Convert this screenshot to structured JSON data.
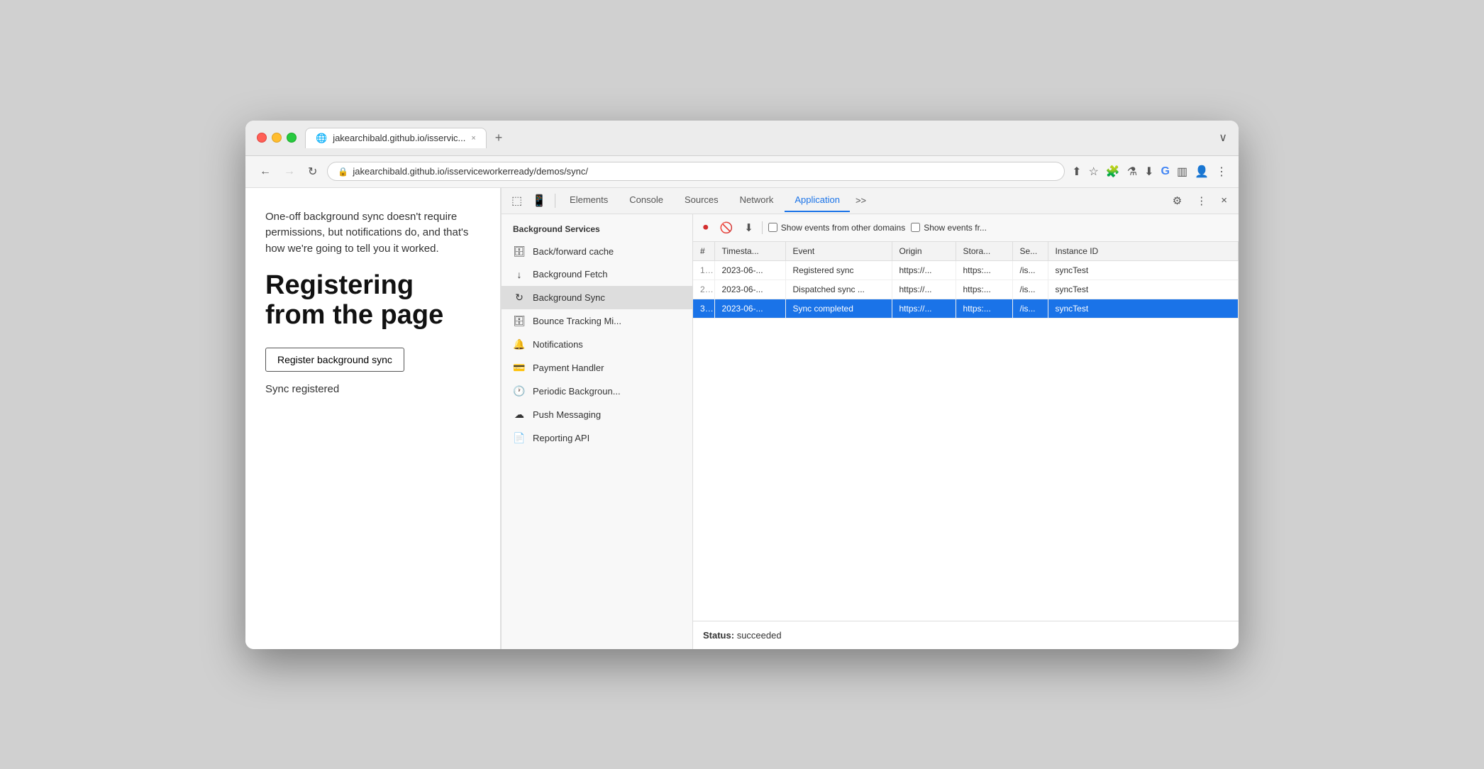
{
  "browser": {
    "tab_label": "jakearchibald.github.io/isservic...",
    "tab_close": "×",
    "tab_new": "+",
    "tab_overflow": "∨",
    "nav_back": "←",
    "nav_forward": "→",
    "nav_refresh": "↻",
    "address_lock": "🔒",
    "address_url_highlight": "jakearchibald.github.io",
    "address_url_path": "/isserviceworkerready/demos/sync/",
    "address_full": "jakearchibald.github.io/isserviceworkerready/demos/sync/"
  },
  "page": {
    "description": "One-off background sync doesn't require permissions, but notifications do, and that's how we're going to tell you it worked.",
    "heading": "Registering from the page",
    "register_btn": "Register background sync",
    "sync_status": "Sync registered"
  },
  "devtools": {
    "tabs": [
      "Elements",
      "Console",
      "Sources",
      "Network",
      "Application"
    ],
    "active_tab": "Application",
    "more_tabs": ">>",
    "settings_icon": "⚙",
    "more_icon": "⋮",
    "close_icon": "×"
  },
  "panel": {
    "record_icon": "⏺",
    "clear_icon": "🚫",
    "download_icon": "⬇",
    "checkbox1_label": "Show events from other domains",
    "checkbox2_label": "Show events fr..."
  },
  "sidebar": {
    "section_title": "Background Services",
    "items": [
      {
        "id": "back-forward-cache",
        "icon": "🗄",
        "label": "Back/forward cache"
      },
      {
        "id": "background-fetch",
        "icon": "↓",
        "label": "Background Fetch"
      },
      {
        "id": "background-sync",
        "icon": "↻",
        "label": "Background Sync",
        "active": true
      },
      {
        "id": "bounce-tracking",
        "icon": "🗄",
        "label": "Bounce Tracking Mi..."
      },
      {
        "id": "notifications",
        "icon": "🔔",
        "label": "Notifications"
      },
      {
        "id": "payment-handler",
        "icon": "💳",
        "label": "Payment Handler"
      },
      {
        "id": "periodic-background",
        "icon": "🕐",
        "label": "Periodic Backgroun..."
      },
      {
        "id": "push-messaging",
        "icon": "☁",
        "label": "Push Messaging"
      },
      {
        "id": "reporting-api",
        "icon": "📄",
        "label": "Reporting API"
      }
    ]
  },
  "table": {
    "headers": [
      "#",
      "Timestа...",
      "Event",
      "Origin",
      "Storа...",
      "Se...",
      "Instance ID"
    ],
    "rows": [
      {
        "num": "1.",
        "timestamp": "2023-06-...",
        "event": "Registered sync",
        "origin": "https://...",
        "storage": "https:...",
        "se": "/is...",
        "instance_id": "syncTest",
        "selected": false
      },
      {
        "num": "2.",
        "timestamp": "2023-06-...",
        "event": "Dispatched sync ...",
        "origin": "https://...",
        "storage": "https:...",
        "se": "/is...",
        "instance_id": "syncTest",
        "selected": false
      },
      {
        "num": "3.",
        "timestamp": "2023-06-...",
        "event": "Sync completed",
        "origin": "https://...",
        "storage": "https:...",
        "se": "/is...",
        "instance_id": "syncTest",
        "selected": true
      }
    ]
  },
  "status": {
    "label": "Status:",
    "value": "succeeded"
  }
}
